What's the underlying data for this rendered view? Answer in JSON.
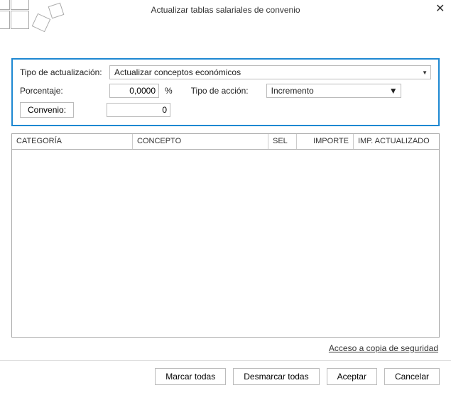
{
  "window": {
    "title": "Actualizar tablas salariales de convenio"
  },
  "params": {
    "tipo_actualizacion_label": "Tipo de actualización:",
    "tipo_actualizacion_value": "Actualizar conceptos económicos",
    "porcentaje_label": "Porcentaje:",
    "porcentaje_value": "0,0000",
    "porcentaje_sign": "%",
    "tipo_accion_label": "Tipo de acción:",
    "tipo_accion_value": "Incremento",
    "convenio_button": "Convenio:",
    "convenio_value": "0"
  },
  "grid": {
    "columns": {
      "categoria": "CATEGORÍA",
      "concepto": "CONCEPTO",
      "sel": "SEL",
      "importe": "IMPORTE",
      "imp_actualizado": "IMP. ACTUALIZADO"
    }
  },
  "links": {
    "backup": "Acceso a copia de seguridad"
  },
  "footer": {
    "marcar_todas": "Marcar todas",
    "desmarcar_todas": "Desmarcar todas",
    "aceptar": "Aceptar",
    "cancelar": "Cancelar"
  }
}
